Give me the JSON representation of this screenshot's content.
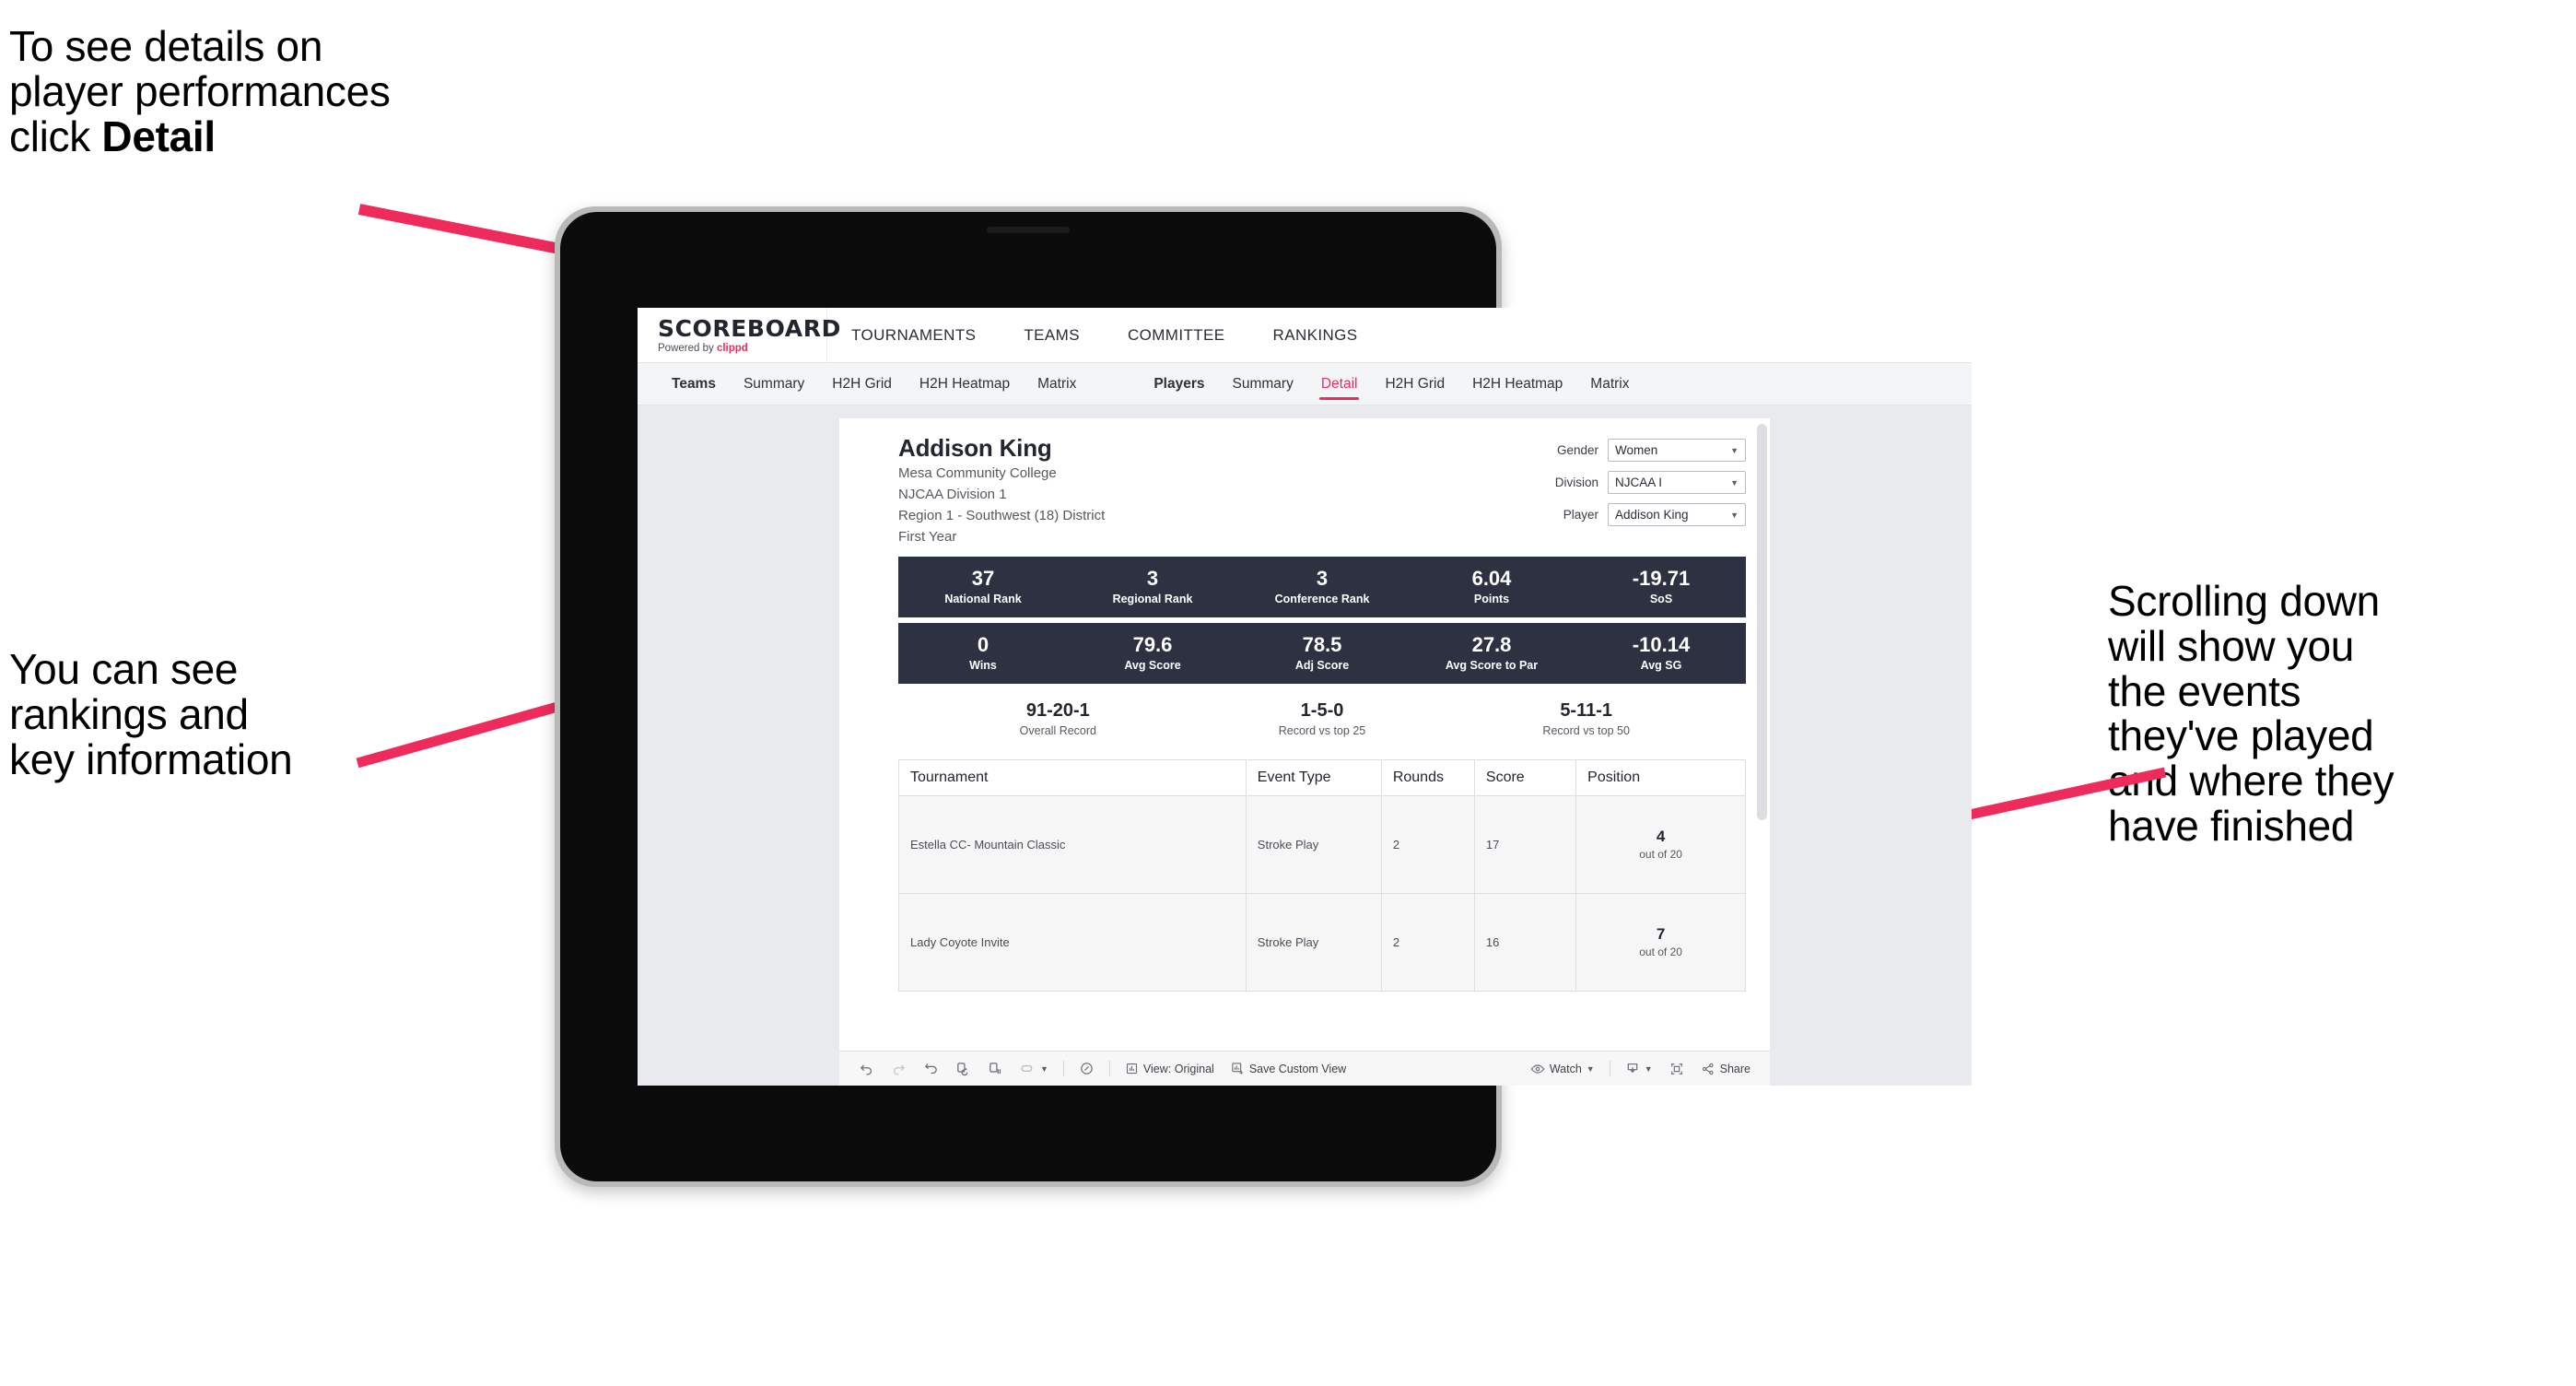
{
  "annotations": {
    "top_left": "To see details on\nplayer performances\nclick ",
    "top_left_bold": "Detail",
    "mid_left": "You can see\nrankings and\nkey information",
    "right": "Scrolling down\nwill show you\nthe events\nthey've played\nand where they\nhave finished",
    "arrow_color": "#ef2b5c"
  },
  "app": {
    "brand": {
      "title": "SCOREBOARD",
      "powered_prefix": "Powered by ",
      "powered_brand": "clippd"
    },
    "topnav": [
      "TOURNAMENTS",
      "TEAMS",
      "COMMITTEE",
      "RANKINGS"
    ],
    "tabs_teams": [
      "Teams",
      "Summary",
      "H2H Grid",
      "H2H Heatmap",
      "Matrix"
    ],
    "tabs_players": [
      "Players",
      "Summary",
      "Detail",
      "H2H Grid",
      "H2H Heatmap",
      "Matrix"
    ],
    "active_tab": "Detail",
    "accent": "#ef2b5c",
    "statbar_color": "#2d3142"
  },
  "player": {
    "name": "Addison King",
    "school": "Mesa Community College",
    "division": "NJCAA Division 1",
    "region": "Region 1 - Southwest (18) District",
    "year": "First Year"
  },
  "filters": [
    {
      "label": "Gender",
      "value": "Women"
    },
    {
      "label": "Division",
      "value": "NJCAA I"
    },
    {
      "label": "Player",
      "value": "Addison King"
    }
  ],
  "stats_row1": [
    {
      "value": "37",
      "label": "National Rank"
    },
    {
      "value": "3",
      "label": "Regional Rank"
    },
    {
      "value": "3",
      "label": "Conference Rank"
    },
    {
      "value": "6.04",
      "label": "Points"
    },
    {
      "value": "-19.71",
      "label": "SoS"
    }
  ],
  "stats_row2": [
    {
      "value": "0",
      "label": "Wins"
    },
    {
      "value": "79.6",
      "label": "Avg Score"
    },
    {
      "value": "78.5",
      "label": "Adj Score"
    },
    {
      "value": "27.8",
      "label": "Avg Score to Par"
    },
    {
      "value": "-10.14",
      "label": "Avg SG"
    }
  ],
  "records": [
    {
      "value": "91-20-1",
      "label": "Overall Record"
    },
    {
      "value": "1-5-0",
      "label": "Record vs top 25"
    },
    {
      "value": "5-11-1",
      "label": "Record vs top 50"
    }
  ],
  "events_table": {
    "columns": [
      "Tournament",
      "Event Type",
      "Rounds",
      "Score",
      "Position"
    ],
    "rows": [
      {
        "tournament": "Estella CC- Mountain Classic",
        "event_type": "Stroke Play",
        "rounds": "2",
        "score": "17",
        "position": "4",
        "position_out_of": "out of 20"
      },
      {
        "tournament": "Lady Coyote Invite",
        "event_type": "Stroke Play",
        "rounds": "2",
        "score": "16",
        "position": "7",
        "position_out_of": "out of 20"
      }
    ]
  },
  "toolbar": {
    "view_label": "View: Original",
    "save_label": "Save Custom View",
    "watch_label": "Watch",
    "share_label": "Share"
  }
}
